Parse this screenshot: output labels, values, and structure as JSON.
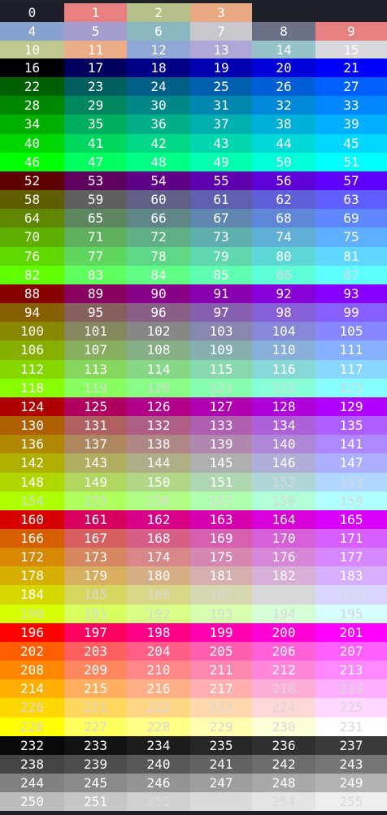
{
  "palette": {
    "system_colors": [
      {
        "label": "0",
        "bg": "#1c1e29",
        "fg": "#ffffff"
      },
      {
        "label": "1",
        "bg": "#e78080",
        "fg": "#ffffff"
      },
      {
        "label": "2",
        "bg": "#b5c08a",
        "fg": "#ffffff"
      },
      {
        "label": "3",
        "bg": "#e8a882",
        "fg": "#ffffff"
      },
      {
        "label": "4",
        "bg": "#86a2cc",
        "fg": "#ffffff"
      },
      {
        "label": "5",
        "bg": "#a69dcf",
        "fg": "#ffffff"
      },
      {
        "label": "6",
        "bg": "#8ab7c0",
        "fg": "#ffffff"
      },
      {
        "label": "7",
        "bg": "#c6c8ce",
        "fg": "#ffffff"
      },
      {
        "label": "8",
        "bg": "#6c7086",
        "fg": "#ffffff"
      },
      {
        "label": "9",
        "bg": "#e78080",
        "fg": "#ffffff"
      },
      {
        "label": "10",
        "bg": "#bfc98f",
        "fg": "#ffffff"
      },
      {
        "label": "11",
        "bg": "#eaad86",
        "fg": "#ffffff"
      },
      {
        "label": "12",
        "bg": "#8fa9d4",
        "fg": "#ffffff"
      },
      {
        "label": "13",
        "bg": "#b0a6d6",
        "fg": "#ffffff"
      },
      {
        "label": "14",
        "bg": "#96c3cb",
        "fg": "#ffffff"
      },
      {
        "label": "15",
        "bg": "#d7d9de",
        "fg": "#ffffff"
      }
    ]
  }
}
